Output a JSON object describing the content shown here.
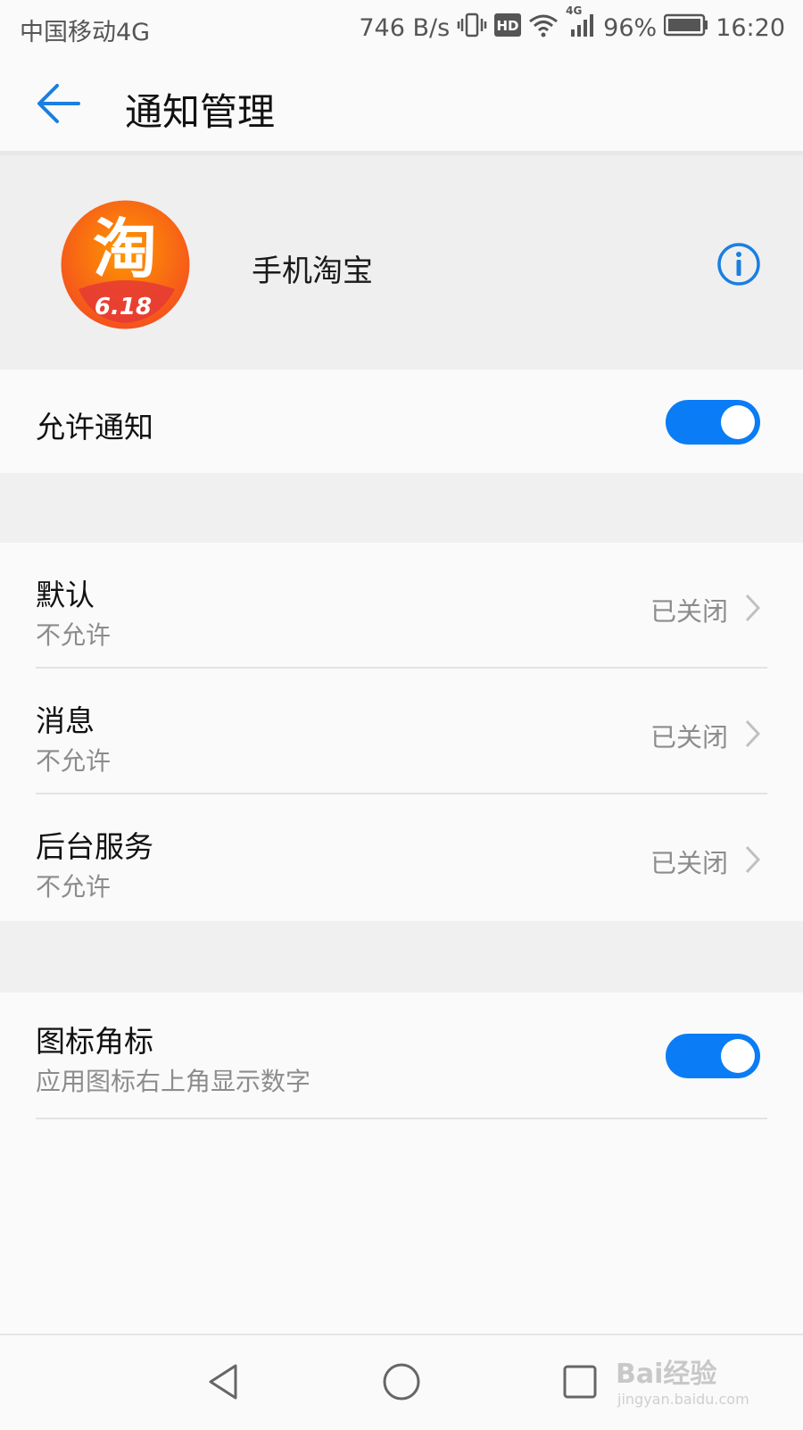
{
  "status_bar": {
    "carrier": "中国移动4G",
    "speed": "746 B/s",
    "hd": "HD",
    "network_badge": "4G",
    "battery": "96%",
    "time": "16:20",
    "icons": [
      "vibrate-icon",
      "hd-icon",
      "wifi-icon",
      "signal-icon",
      "battery-icon"
    ]
  },
  "header": {
    "title": "通知管理",
    "back_icon": "arrow-left-icon"
  },
  "app": {
    "name": "手机淘宝",
    "logo_char": "淘",
    "logo_badge": "6.18",
    "info_icon": "info-icon",
    "logo_colors": [
      "#f4511e",
      "#ffb300"
    ]
  },
  "allow_notifications": {
    "label": "允许通知",
    "enabled": true
  },
  "channels": [
    {
      "title": "默认",
      "subtitle": "不允许",
      "status": "已关闭"
    },
    {
      "title": "消息",
      "subtitle": "不允许",
      "status": "已关闭"
    },
    {
      "title": "后台服务",
      "subtitle": "不允许",
      "status": "已关闭"
    }
  ],
  "badge_setting": {
    "title": "图标角标",
    "subtitle": "应用图标右上角显示数字",
    "enabled": true
  },
  "nav": {
    "back": "triangle-back-icon",
    "home": "circle-home-icon",
    "recents": "square-recents-icon"
  },
  "watermark": {
    "brand": "Bai经验",
    "url": "jingyan.baidu.com"
  },
  "colors": {
    "accent": "#0a7cf5",
    "text": "#111111",
    "secondary": "#8c8c8c"
  }
}
